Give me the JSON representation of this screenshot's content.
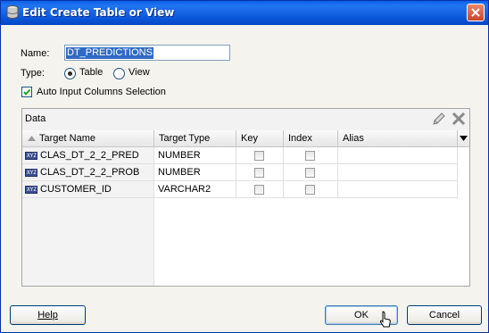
{
  "window": {
    "title": "Edit Create Table or View"
  },
  "form": {
    "name_label": "Name:",
    "name_value": "DT_PREDICTIONS",
    "type_label": "Type:",
    "type_options": [
      "Table",
      "View"
    ],
    "type_selected": "Table",
    "auto_input_label": "Auto Input Columns Selection",
    "auto_input_checked": true
  },
  "data_panel": {
    "title": "Data",
    "columns": [
      "Target Name",
      "Target Type",
      "Key",
      "Index",
      "Alias"
    ],
    "rows": [
      {
        "icon": "xyz",
        "name": "CLAS_DT_2_2_PRED",
        "type": "NUMBER",
        "key": false,
        "index": false,
        "alias": ""
      },
      {
        "icon": "xyz",
        "name": "CLAS_DT_2_2_PROB",
        "type": "NUMBER",
        "key": false,
        "index": false,
        "alias": ""
      },
      {
        "icon": "xyz",
        "name": "CUSTOMER_ID",
        "type": "VARCHAR2",
        "key": false,
        "index": false,
        "alias": ""
      }
    ]
  },
  "buttons": {
    "help": "Help",
    "ok": "OK",
    "cancel": "Cancel"
  },
  "icons": [
    "database-icon",
    "close-icon",
    "pencil-icon",
    "delete-icon",
    "sort-ascending-icon",
    "column-menu-icon",
    "xyz-column-icon",
    "mouse-cursor-icon"
  ]
}
